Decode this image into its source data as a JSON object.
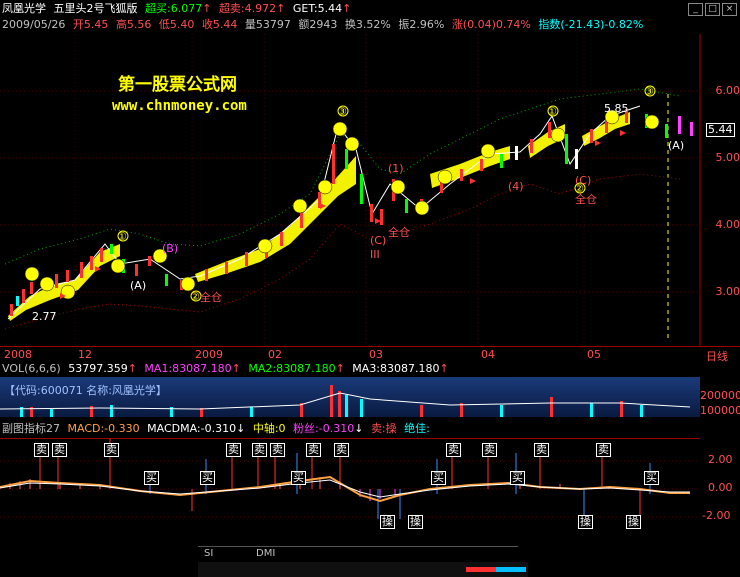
{
  "header": {
    "line1": {
      "name": "凤凰光学",
      "indicator": "五里头2号飞狐版",
      "chaomai_label": "超买:",
      "chaomai_value": "6.077",
      "chaomai_arrow": "↑",
      "chaoma2_label": "超卖:",
      "chaoma2_value": "4.972",
      "chaoma2_arrow": "↑",
      "get_label": "GET:",
      "get_value": "5.44",
      "get_arrow": "↑"
    },
    "line2": {
      "date": "2009/05/26",
      "open": "开5.45",
      "high": "高5.56",
      "low": "低5.40",
      "close": "收5.44",
      "volume": "量53797",
      "amount": "额2943",
      "turnover": "换3.52%",
      "amplitude": "振2.96%",
      "change": "涨(0.04)0.74%",
      "index": "指数(-21.43)-0.82%"
    }
  },
  "site": {
    "name": "第一股票公式网",
    "url": "www.chnmoney.com"
  },
  "main_chart": {
    "price_labels": [
      "6.00",
      "5.00",
      "4.00",
      "3.00"
    ],
    "current_price": "5.44",
    "low_label": "2.77",
    "high_label": "5.85",
    "date_labels": [
      "2008",
      "12",
      "2009",
      "02",
      "03",
      "04",
      "05"
    ],
    "period_label": "日线",
    "annotations": [
      "①",
      "②",
      "③",
      "(A)",
      "(B)",
      "(C)",
      "全仓",
      "III",
      "(1)",
      "(4)",
      "(A)"
    ],
    "zhuan_label": "全仓",
    "colors": {
      "up": "#ff3030",
      "down": "#00ffff",
      "band": "#ffff00",
      "smile": "#ffff00"
    }
  },
  "volume_panel": {
    "title": "VOL(6,6,6)",
    "vol": "53797.359",
    "ma1": "MA1:83087.180",
    "ma2": "MA2:83087.180",
    "ma3": "MA3:83087.180",
    "code_label": "【代码:600071 名称:风凰光学】",
    "scale_labels": [
      "200000",
      "100000"
    ]
  },
  "macd_panel": {
    "title": "副图指标27",
    "macd": "MACD:-0.330",
    "macdma": "MACDMA:-0.310",
    "zhongzhou": "中轴:0",
    "fensi": "粉丝:-0.310",
    "maicao": "卖:操",
    "juejia": "绝佳:",
    "scale_labels": [
      "2.00",
      "0.00",
      "-2.00"
    ],
    "sell_label": "卖",
    "buy_label": "买",
    "op_label": "操"
  },
  "bottom_tabs": [
    "SI",
    "DMI"
  ]
}
